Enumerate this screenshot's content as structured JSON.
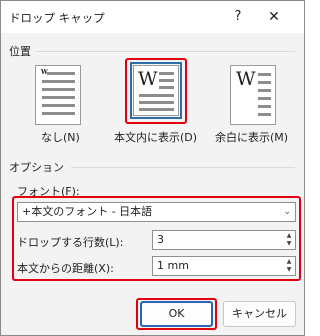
{
  "dialog": {
    "title": "ドロップ キャップ",
    "help": "?",
    "close": "✕"
  },
  "position": {
    "section_title": "位置",
    "options": [
      {
        "label": "なし(N)",
        "glyph": "W",
        "selected": false
      },
      {
        "label": "本文内に表示(D)",
        "glyph": "W",
        "selected": true
      },
      {
        "label": "余白に表示(M)",
        "glyph": "W",
        "selected": false
      }
    ]
  },
  "options": {
    "section_title": "オプション",
    "font_label": "フォント(F):",
    "font_value": "+本文のフォント - 日本語",
    "lines_label": "ドロップする行数(L):",
    "lines_value": "3",
    "distance_label": "本文からの距離(X):",
    "distance_value": "1 mm"
  },
  "buttons": {
    "ok": "OK",
    "cancel": "キャンセル"
  },
  "icons": {
    "dropdown": "chevron-down-icon",
    "spin_up": "spin-up-icon",
    "spin_down": "spin-down-icon",
    "help": "question-icon",
    "close": "close-icon"
  },
  "colors": {
    "highlight": "#e0000f",
    "selection": "#2d6ea5",
    "default_button": "#2b63b6"
  }
}
